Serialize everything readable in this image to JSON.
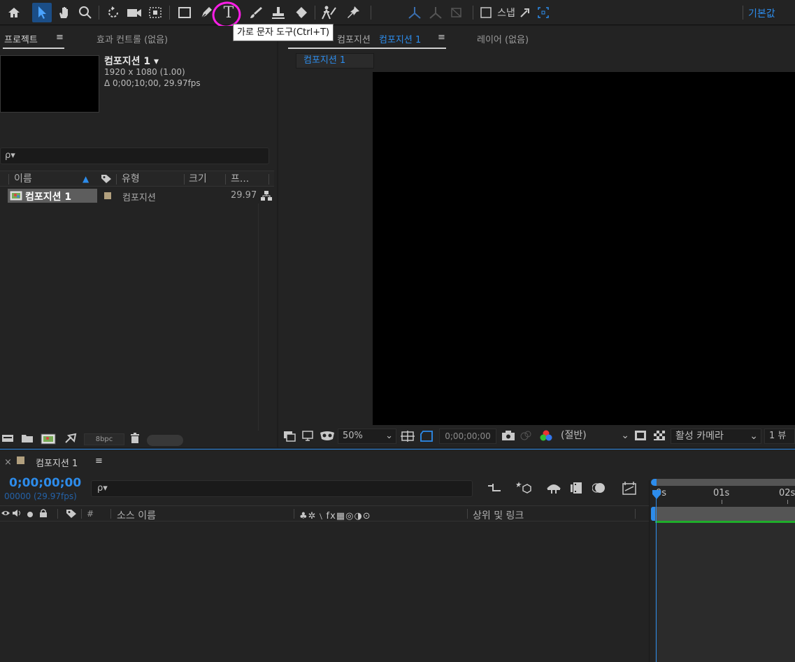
{
  "toolbar": {
    "tools": [
      {
        "name": "home-icon",
        "glyph": "⌂"
      },
      {
        "name": "selection-tool-icon",
        "glyph": "▶"
      },
      {
        "name": "hand-tool-icon",
        "glyph": "✋"
      },
      {
        "name": "zoom-tool-icon",
        "glyph": "🔍"
      },
      {
        "name": "rotation-tool-icon",
        "glyph": "↻"
      },
      {
        "name": "camera-tool-icon",
        "glyph": "■"
      },
      {
        "name": "pan-behind-tool-icon",
        "glyph": "⊡"
      },
      {
        "name": "rectangle-tool-icon",
        "glyph": "□"
      },
      {
        "name": "pen-tool-icon",
        "glyph": "✒"
      },
      {
        "name": "type-tool-icon",
        "glyph": "T"
      },
      {
        "name": "brush-tool-icon",
        "glyph": "∕"
      },
      {
        "name": "clone-stamp-tool-icon",
        "glyph": "⊥"
      },
      {
        "name": "eraser-tool-icon",
        "glyph": "◆"
      },
      {
        "name": "roto-brush-tool-icon",
        "glyph": "✧"
      },
      {
        "name": "puppet-pin-tool-icon",
        "glyph": "✦"
      },
      {
        "name": "axis-local-icon",
        "glyph": "⅄"
      },
      {
        "name": "axis-world-icon",
        "glyph": "⅄"
      },
      {
        "name": "axis-view-icon",
        "glyph": "⊠"
      }
    ],
    "snap_label": "스냅",
    "workspace": "기본값",
    "tooltip": "가로 문자 도구(Ctrl+T)"
  },
  "project_panel": {
    "tab_project": "프로젝트",
    "tab_effects": "효과 컨트롤 (없음)",
    "comp_name": "컴포지션 1 ▾",
    "comp_size": "1920 x 1080 (1.00)",
    "comp_duration": "Δ 0;00;10;00, 29.97fps",
    "search_placeholder": "ρ▾",
    "columns": {
      "name": "이름",
      "type": "유형",
      "size": "크기",
      "fps": "프..."
    },
    "rows": [
      {
        "name": "컴포지션 1",
        "type": "컴포지션",
        "fps": "29.97"
      }
    ],
    "bpc": "8bpc"
  },
  "viewer": {
    "tab_comp_prefix": "컴포지션",
    "tab_comp_name": "컴포지션 1",
    "tab_layer": "레이어 (없음)",
    "breadcrumb": "컴포지션 1",
    "zoom": "50%",
    "timecode": "0;00;00;00",
    "resolution": "(절반)",
    "camera": "활성 카메라",
    "views": "1 뷰"
  },
  "timeline": {
    "comp_tab": "컴포지션 1",
    "timecode": "0;00;00;00",
    "frames": "00000 (29.97fps)",
    "search_placeholder": "ρ▾",
    "col_number": "#",
    "col_source": "소스 이름",
    "col_switches": "♣✲﹨fx▦◎◑⊙",
    "col_parent": "상위 및 링크",
    "ruler": [
      "0s",
      "01s",
      "02s"
    ]
  },
  "colors": {
    "accent": "#2d8ceb",
    "highlight": "#ff00ff",
    "comp_label": "#b2a07e"
  }
}
